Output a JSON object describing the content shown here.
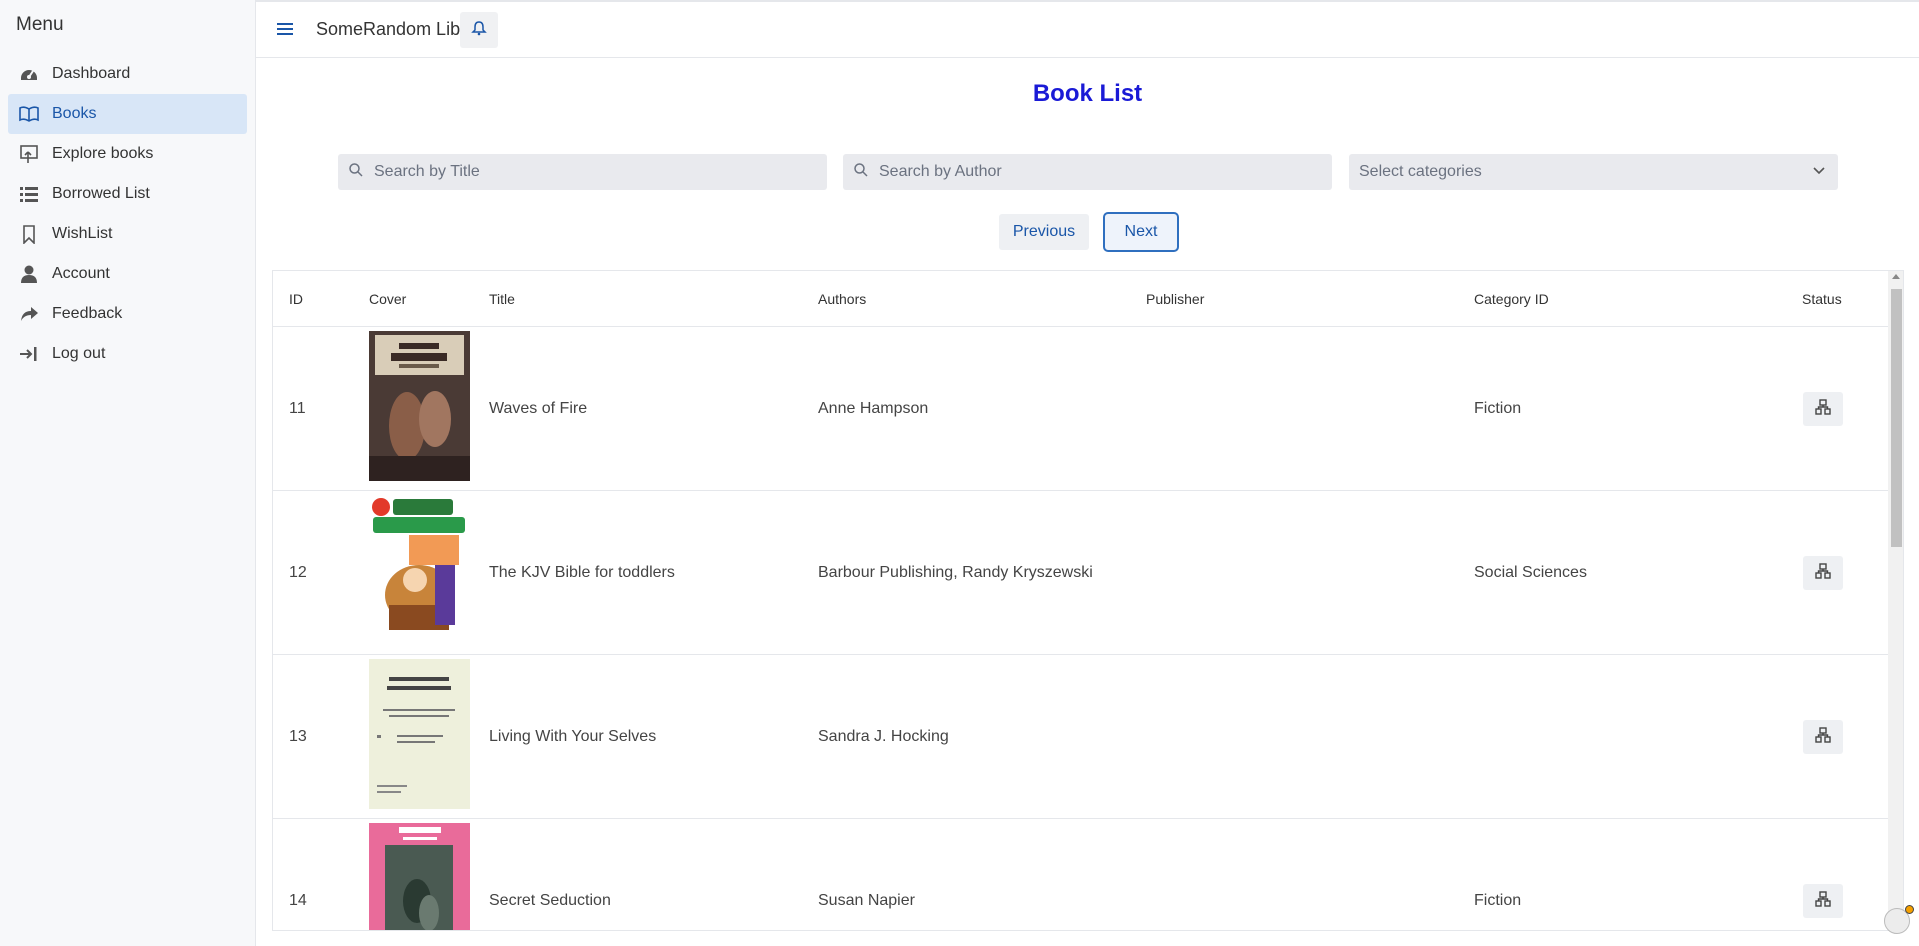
{
  "sidebar": {
    "title": "Menu",
    "items": [
      {
        "label": "Dashboard",
        "icon": "dashboard-icon"
      },
      {
        "label": "Books",
        "icon": "book-open-icon",
        "active": true
      },
      {
        "label": "Explore books",
        "icon": "explore-icon"
      },
      {
        "label": "Borrowed List",
        "icon": "list-icon"
      },
      {
        "label": "WishList",
        "icon": "bookmark-icon"
      },
      {
        "label": "Account",
        "icon": "user-icon"
      },
      {
        "label": "Feedback",
        "icon": "share-icon"
      },
      {
        "label": "Log out",
        "icon": "logout-icon"
      }
    ]
  },
  "header": {
    "app_title": "SomeRandom Lib",
    "menu_icon": "hamburger-icon",
    "notification_icon": "bell-icon"
  },
  "main": {
    "title": "Book List",
    "search_title_placeholder": "Search by Title",
    "search_author_placeholder": "Search by Author",
    "category_placeholder": "Select categories",
    "prev_label": "Previous",
    "next_label": "Next"
  },
  "table": {
    "columns": [
      "ID",
      "Cover",
      "Title",
      "Authors",
      "Publisher",
      "Category ID",
      "Status"
    ],
    "rows": [
      {
        "id": "11",
        "title": "Waves of Fire",
        "authors": "Anne Hampson",
        "publisher": "",
        "category": "Fiction"
      },
      {
        "id": "12",
        "title": "The KJV Bible for toddlers",
        "authors": "Barbour Publishing, Randy Kryszewski",
        "publisher": "",
        "category": "Social Sciences"
      },
      {
        "id": "13",
        "title": "Living With Your Selves",
        "authors": "Sandra J. Hocking",
        "publisher": "",
        "category": ""
      },
      {
        "id": "14",
        "title": "Secret Seduction",
        "authors": "Susan Napier",
        "publisher": "",
        "category": "Fiction"
      }
    ]
  },
  "colors": {
    "accent": "#1a56a8",
    "title": "#1a1ad6",
    "active_nav_bg": "#d8e6f7"
  }
}
